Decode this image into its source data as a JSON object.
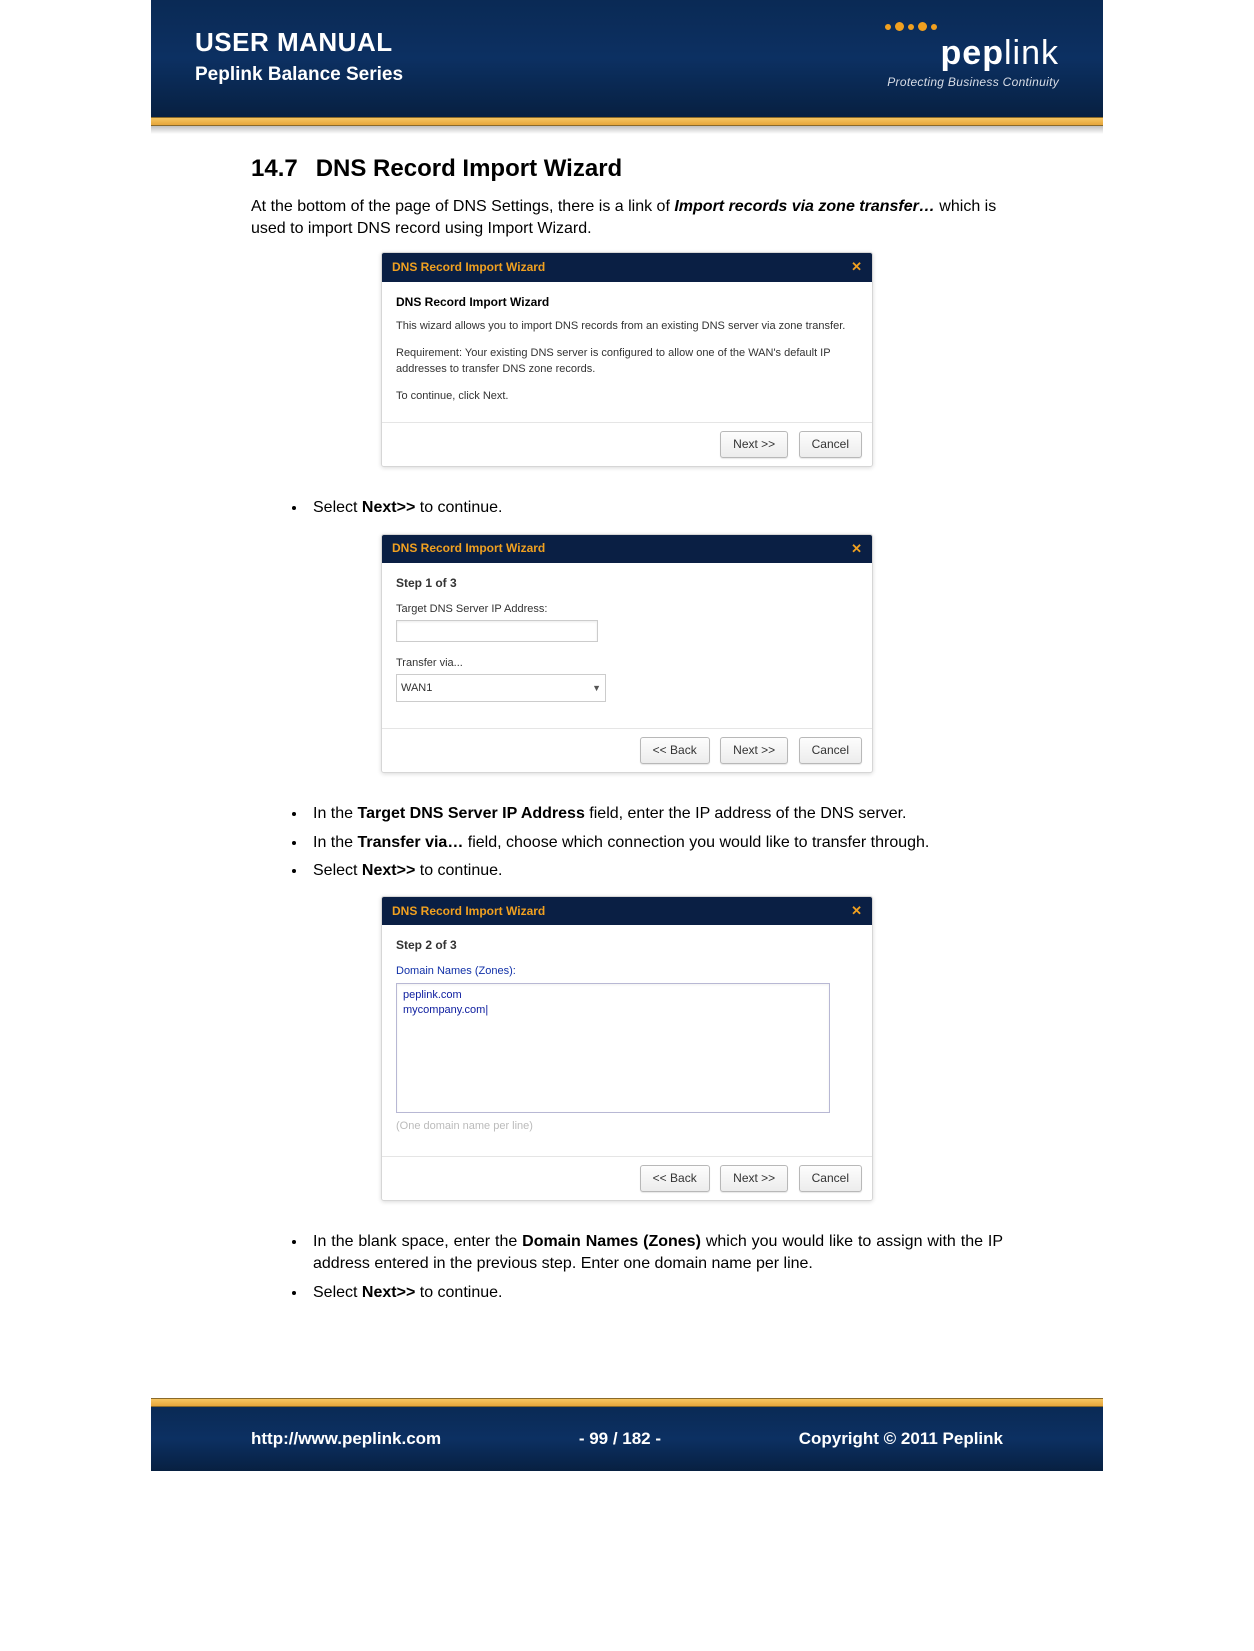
{
  "header": {
    "title": "USER MANUAL",
    "subtitle": "Peplink Balance Series",
    "brand": "peplink",
    "tagline": "Protecting Business Continuity"
  },
  "section": {
    "number": "14.7",
    "title": "DNS Record Import Wizard",
    "intro_pre": "At the bottom of the page of DNS Settings, there is a link of ",
    "intro_link": "Import records via zone transfer…",
    "intro_post": " which is used to import DNS record using Import Wizard."
  },
  "wizard": {
    "title": "DNS Record Import Wizard",
    "close": "✕",
    "intro": {
      "heading": "DNS Record Import Wizard",
      "p1": "This wizard allows you to import DNS records from an existing DNS server via zone transfer.",
      "p2": "Requirement: Your existing DNS server is configured to allow one of the WAN's default IP addresses to transfer DNS zone records.",
      "p3": "To continue, click Next."
    },
    "buttons": {
      "back": "<< Back",
      "next": "Next >>",
      "cancel": "Cancel"
    },
    "step1": {
      "step": "Step 1 of 3",
      "label_ip": "Target DNS Server IP Address:",
      "label_via": "Transfer via...",
      "via_value": "WAN1"
    },
    "step2": {
      "step": "Step 2 of 3",
      "label_dom": "Domain Names (Zones):",
      "domains": "peplink.com\nmycompany.com|",
      "hint": "(One domain name per line)"
    }
  },
  "bullets": {
    "b1_pre": "Select ",
    "b1_b": "Next>>",
    "b1_post": " to continue.",
    "b2_pre": "In the ",
    "b2_b": "Target DNS Server IP Address",
    "b2_post": " field, enter the IP address of the DNS server.",
    "b3_pre": "In the ",
    "b3_b": "Transfer via…",
    "b3_post": " field, choose which connection you would like to transfer through.",
    "b4_pre": "Select ",
    "b4_b": "Next>>",
    "b4_post": " to continue.",
    "b5_pre": "In the blank space, enter the ",
    "b5_b": "Domain Names (Zones)",
    "b5_post": " which you would like to assign with the IP address entered in the previous step. Enter one domain name per line.",
    "b6_pre": "Select ",
    "b6_b": "Next>>",
    "b6_post": " to continue."
  },
  "footer": {
    "url": "http://www.peplink.com",
    "page": "- 99 / 182 -",
    "copyright": "Copyright © 2011 Peplink"
  }
}
